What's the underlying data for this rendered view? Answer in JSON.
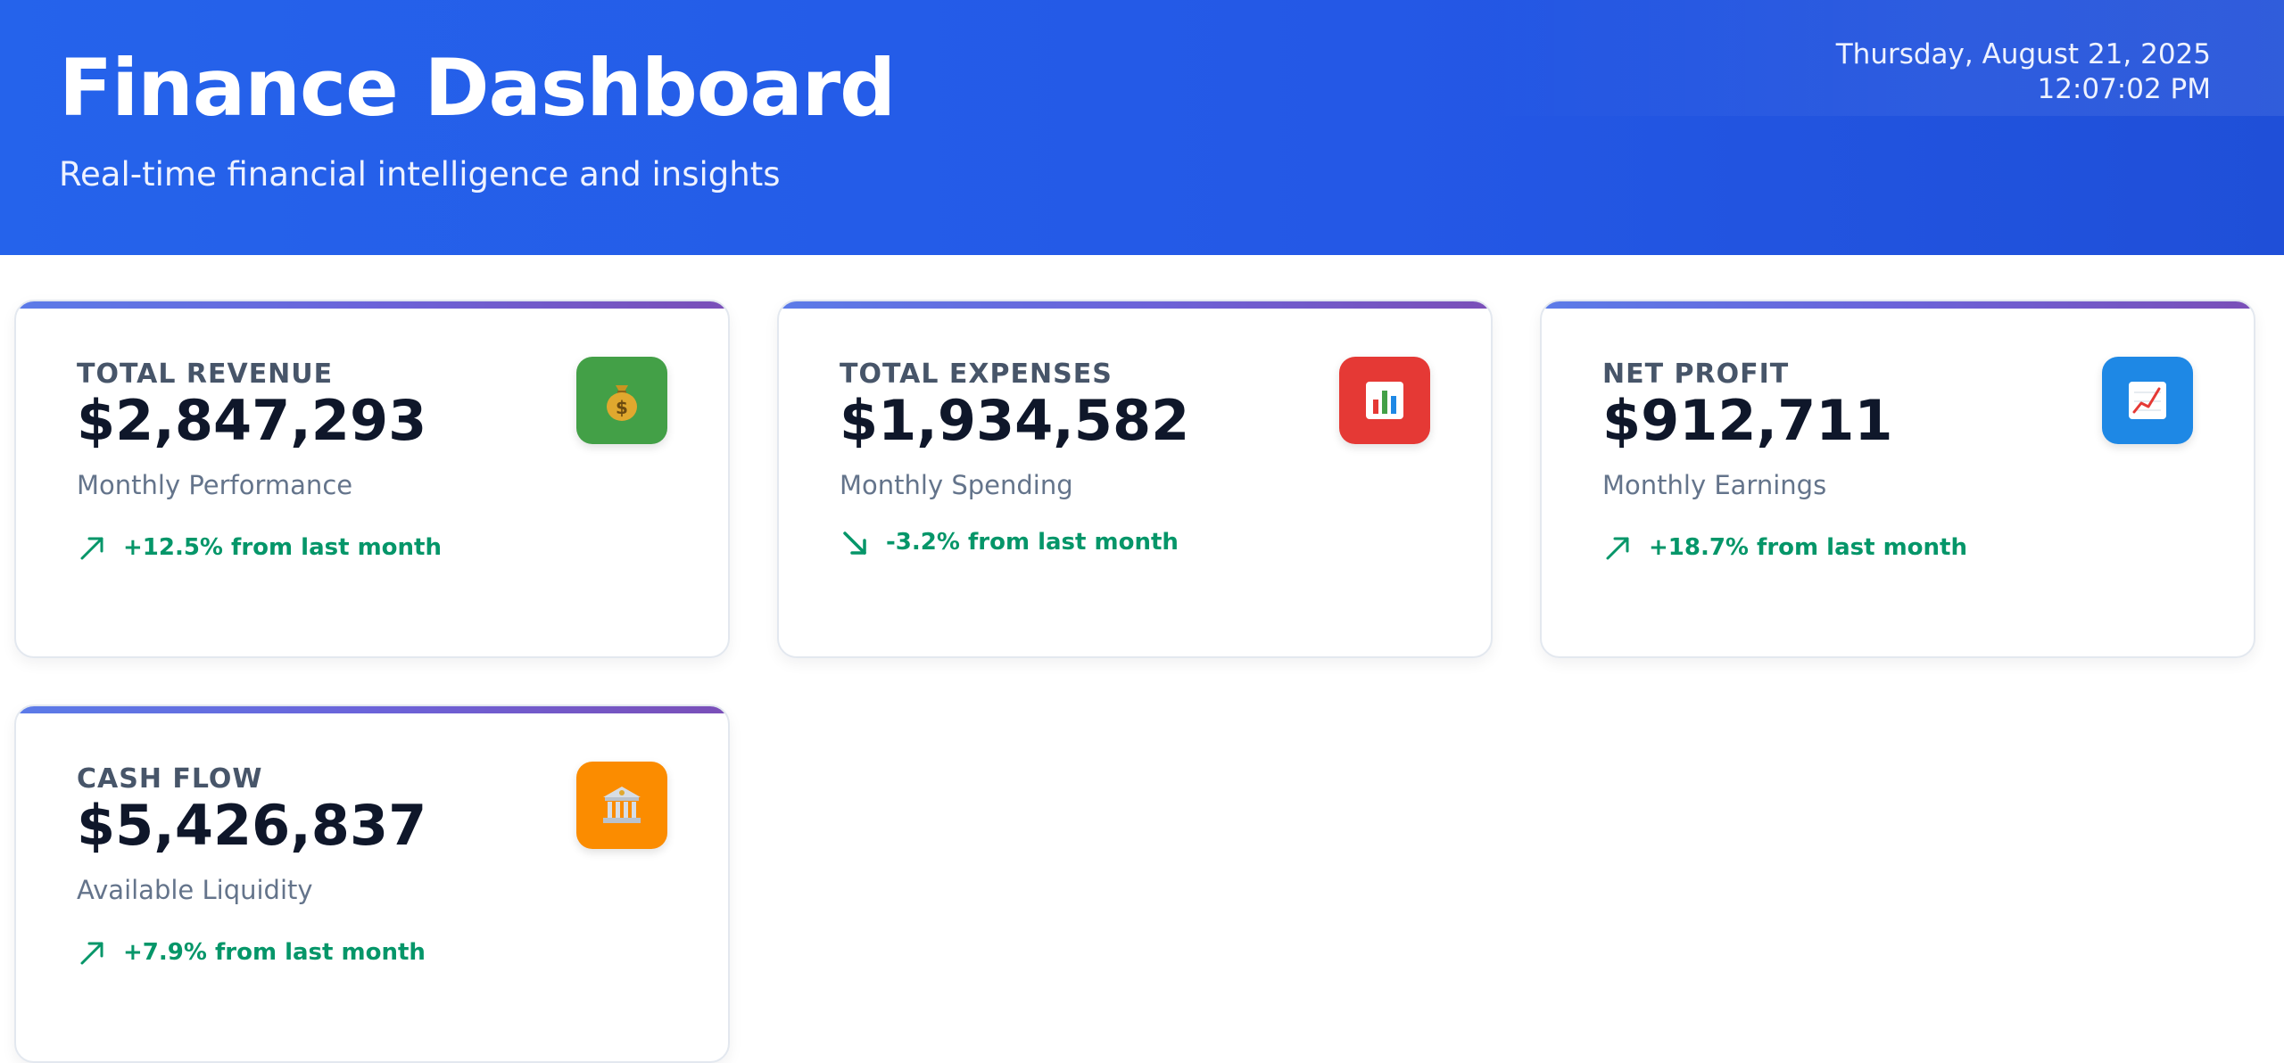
{
  "header": {
    "title": "Finance Dashboard",
    "subtitle": "Real-time financial intelligence and insights",
    "date": "Thursday, August 21, 2025",
    "time": "12:07:02 PM"
  },
  "cards": [
    {
      "label": "TOTAL REVENUE",
      "value": "$2,847,293",
      "caption": "Monthly Performance",
      "trend": "+12.5% from last month",
      "trend_direction": "up",
      "icon": "money-bag-icon",
      "icon_color": "#43a047"
    },
    {
      "label": "TOTAL EXPENSES",
      "value": "$1,934,582",
      "caption": "Monthly Spending",
      "trend": "-3.2% from last month",
      "trend_direction": "down",
      "icon": "bar-chart-icon",
      "icon_color": "#e53935"
    },
    {
      "label": "NET PROFIT",
      "value": "$912,711",
      "caption": "Monthly Earnings",
      "trend": "+18.7% from last month",
      "trend_direction": "up",
      "icon": "trending-up-chart-icon",
      "icon_color": "#1e88e5"
    },
    {
      "label": "CASH FLOW",
      "value": "$5,426,837",
      "caption": "Available Liquidity",
      "trend": "+7.9% from last month",
      "trend_direction": "up",
      "icon": "bank-icon",
      "icon_color": "#fb8c00"
    }
  ],
  "colors": {
    "header_blue": "#2563eb",
    "trend_green": "#059669",
    "accent_bar_start": "#5b7be8",
    "accent_bar_end": "#7a4fb8"
  }
}
